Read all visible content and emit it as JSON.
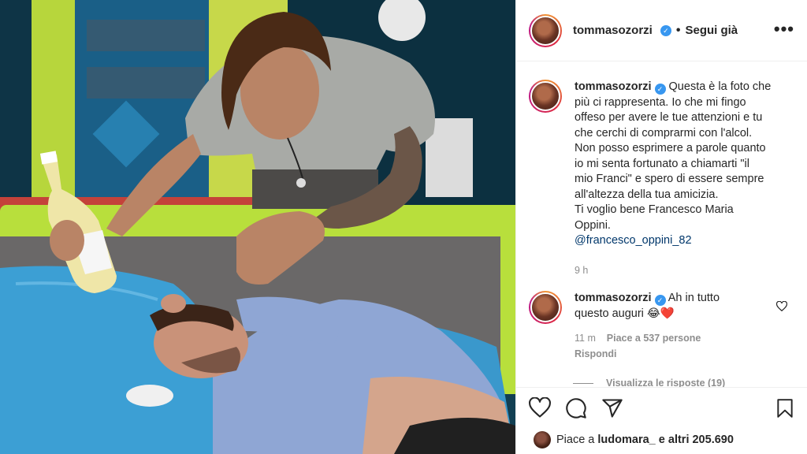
{
  "post": {
    "username": "tommasozorzi",
    "follow_status": "Segui già",
    "more_icon": "more-horizontal-icon"
  },
  "caption": {
    "username": "tommasozorzi",
    "lines": [
      "Questa è la foto che",
      "più ci rappresenta. Io che mi fingo",
      "offeso per avere le tue attenzioni e tu",
      "che cerchi di comprarmi con l'alcol.",
      "Non posso esprimere a parole quanto",
      "io mi senta fortunato a chiamarti \"il",
      "mio Franci\" e spero di essere sempre",
      "all'altezza della tua amicizia.",
      "Ti voglio bene Francesco Maria",
      "Oppini."
    ],
    "mention": "@francesco_oppini_82",
    "time": "9 h"
  },
  "comment": {
    "username": "tommasozorzi",
    "text_line1": "Ah in tutto",
    "text_line2": "questo auguri",
    "emoji": "😂❤️",
    "time": "11 m",
    "likes": "Piace a 537 persone",
    "reply": "Rispondi",
    "view_replies": "Visualizza le risposte (19)"
  },
  "likes_bar": {
    "prefix": "Piace a",
    "user": "ludomara_",
    "suffix": "e altri 205.690"
  },
  "colors": {
    "verified": "#3897f0",
    "link": "#00376b",
    "secondary_text": "#8e8e8e"
  }
}
